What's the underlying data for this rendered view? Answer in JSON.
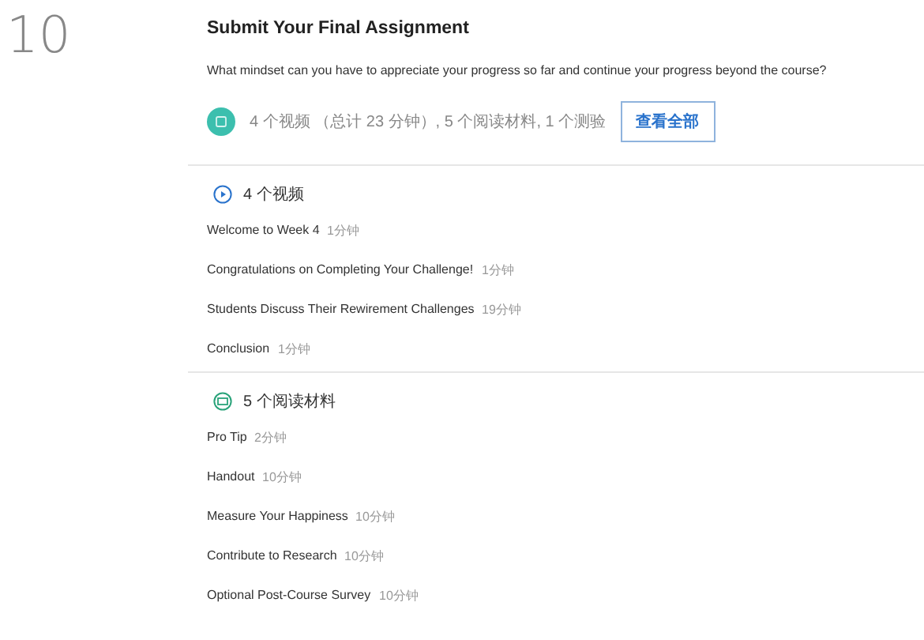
{
  "week_number": "10",
  "title": "Submit Your Final Assignment",
  "description": "What mindset can you have to appreciate your progress so far and continue your progress beyond the course?",
  "summary": {
    "text": "4 个视频 （总计 23 分钟）, 5 个阅读材料, 1 个测验",
    "button": "查看全部"
  },
  "sections": [
    {
      "kind": "video",
      "heading": "4 个视频",
      "items": [
        {
          "title": "Welcome to Week 4",
          "duration": "1分钟"
        },
        {
          "title": "Congratulations on Completing Your Challenge!",
          "duration": "1分钟"
        },
        {
          "title": "Students Discuss Their Rewirement Challenges",
          "duration": "19分钟"
        },
        {
          "title": "Conclusion",
          "duration": "1分钟"
        }
      ]
    },
    {
      "kind": "reading",
      "heading": "5 个阅读材料",
      "items": [
        {
          "title": "Pro Tip",
          "duration": "2分钟"
        },
        {
          "title": "Handout",
          "duration": "10分钟"
        },
        {
          "title": "Measure Your Happiness",
          "duration": "10分钟"
        },
        {
          "title": "Contribute to Research",
          "duration": "10分钟"
        },
        {
          "title": "Optional Post-Course Survey",
          "duration": "10分钟"
        }
      ]
    }
  ]
}
